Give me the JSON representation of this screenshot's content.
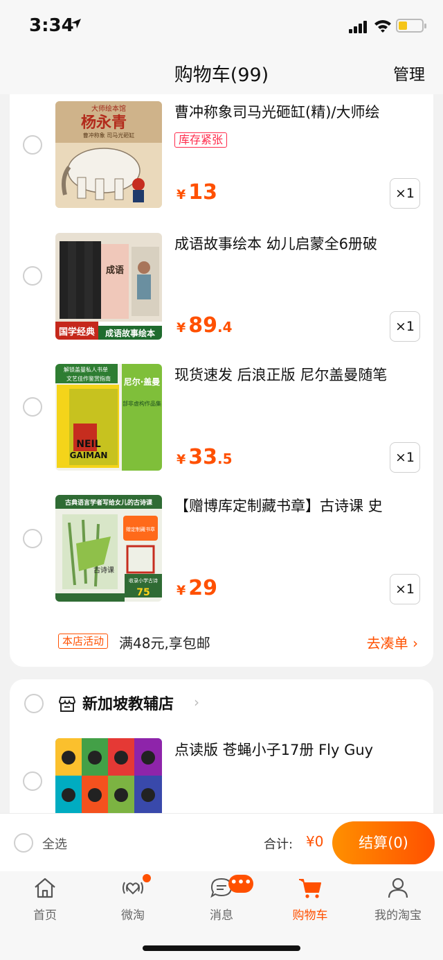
{
  "status_bar": {
    "time": "3:34"
  },
  "header": {
    "title": "购物车(99)",
    "manage": "管理"
  },
  "shop1": {
    "items": [
      {
        "name": "曹冲称象司马光砸缸(精)/大师绘",
        "tag": "库存紧张",
        "currency": "¥",
        "price_int": "13",
        "price_dec": "",
        "qty": "×1"
      },
      {
        "name": "成语故事绘本 幼儿启蒙全6册破",
        "tag": "",
        "currency": "¥",
        "price_int": "89",
        "price_dec": ".4",
        "qty": "×1"
      },
      {
        "name": "现货速发 后浪正版 尼尔盖曼随笔",
        "tag": "",
        "currency": "¥",
        "price_int": "33",
        "price_dec": ".5",
        "qty": "×1"
      },
      {
        "name": "【赠博库定制藏书章】古诗课  史",
        "tag": "",
        "currency": "¥",
        "price_int": "29",
        "price_dec": "",
        "qty": "×1"
      }
    ],
    "cover_text": {
      "c1_series": "大师绘本馆",
      "c1_title": "杨永青",
      "c1_sub": "曹冲称象 司马光砸缸",
      "c2_banner_left": "国学经典",
      "c2_banner_right": "成语故事绘本",
      "c2_book": "成语",
      "c3_top1": "解锁盖曼私人书单",
      "c3_top2": "文艺佳作鉴赏指南",
      "c3_name": "尼尔·盖曼",
      "c3_sub": "部非虚构作品集",
      "c3_en1": "NEIL",
      "c3_en2": "GAIMAN",
      "c4_top": "古典语言学者写给女儿的古诗课",
      "c4_book": "古诗课",
      "c4_stamp": "赠定制藏书章",
      "c4_count": "收录小学古诗",
      "c4_num": "75"
    },
    "promo": {
      "badge": "本店活动",
      "text": "满48元,享包邮",
      "link": "去凑单 ›"
    }
  },
  "shop2": {
    "name": "新加坡教辅店",
    "chevron": "›",
    "items": [
      {
        "name": "点读版 苍蝇小子17册 Fly Guy"
      }
    ]
  },
  "checkout": {
    "select_all": "全选",
    "total_label": "合计:",
    "total_value": "¥0",
    "pay_button": "结算(0)"
  },
  "tabs": [
    {
      "label": "首页",
      "icon": "home-icon"
    },
    {
      "label": "微淘",
      "icon": "heart-radio-icon"
    },
    {
      "label": "消息",
      "icon": "chat-icon"
    },
    {
      "label": "购物车",
      "icon": "cart-icon",
      "active": true
    },
    {
      "label": "我的淘宝",
      "icon": "user-icon"
    }
  ],
  "message_badge": "•••",
  "colors": {
    "accent": "#ff5000",
    "stock_tag": "#ff2a4b",
    "background": "#f2f2f2"
  }
}
